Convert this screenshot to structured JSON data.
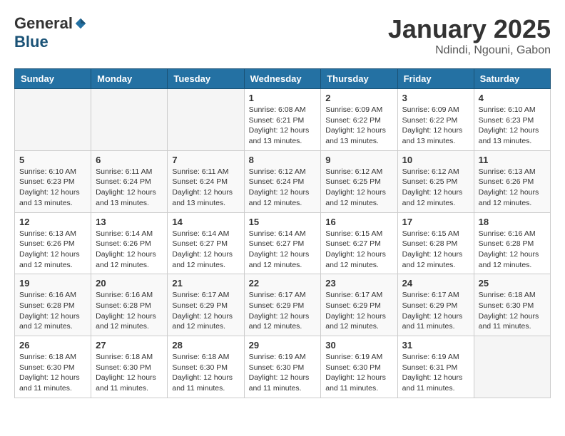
{
  "header": {
    "logo_general": "General",
    "logo_blue": "Blue",
    "month_title": "January 2025",
    "location": "Ndindi, Ngouni, Gabon"
  },
  "weekdays": [
    "Sunday",
    "Monday",
    "Tuesday",
    "Wednesday",
    "Thursday",
    "Friday",
    "Saturday"
  ],
  "weeks": [
    [
      {
        "day": "",
        "info": ""
      },
      {
        "day": "",
        "info": ""
      },
      {
        "day": "",
        "info": ""
      },
      {
        "day": "1",
        "info": "Sunrise: 6:08 AM\nSunset: 6:21 PM\nDaylight: 12 hours\nand 13 minutes."
      },
      {
        "day": "2",
        "info": "Sunrise: 6:09 AM\nSunset: 6:22 PM\nDaylight: 12 hours\nand 13 minutes."
      },
      {
        "day": "3",
        "info": "Sunrise: 6:09 AM\nSunset: 6:22 PM\nDaylight: 12 hours\nand 13 minutes."
      },
      {
        "day": "4",
        "info": "Sunrise: 6:10 AM\nSunset: 6:23 PM\nDaylight: 12 hours\nand 13 minutes."
      }
    ],
    [
      {
        "day": "5",
        "info": "Sunrise: 6:10 AM\nSunset: 6:23 PM\nDaylight: 12 hours\nand 13 minutes."
      },
      {
        "day": "6",
        "info": "Sunrise: 6:11 AM\nSunset: 6:24 PM\nDaylight: 12 hours\nand 13 minutes."
      },
      {
        "day": "7",
        "info": "Sunrise: 6:11 AM\nSunset: 6:24 PM\nDaylight: 12 hours\nand 13 minutes."
      },
      {
        "day": "8",
        "info": "Sunrise: 6:12 AM\nSunset: 6:24 PM\nDaylight: 12 hours\nand 12 minutes."
      },
      {
        "day": "9",
        "info": "Sunrise: 6:12 AM\nSunset: 6:25 PM\nDaylight: 12 hours\nand 12 minutes."
      },
      {
        "day": "10",
        "info": "Sunrise: 6:12 AM\nSunset: 6:25 PM\nDaylight: 12 hours\nand 12 minutes."
      },
      {
        "day": "11",
        "info": "Sunrise: 6:13 AM\nSunset: 6:26 PM\nDaylight: 12 hours\nand 12 minutes."
      }
    ],
    [
      {
        "day": "12",
        "info": "Sunrise: 6:13 AM\nSunset: 6:26 PM\nDaylight: 12 hours\nand 12 minutes."
      },
      {
        "day": "13",
        "info": "Sunrise: 6:14 AM\nSunset: 6:26 PM\nDaylight: 12 hours\nand 12 minutes."
      },
      {
        "day": "14",
        "info": "Sunrise: 6:14 AM\nSunset: 6:27 PM\nDaylight: 12 hours\nand 12 minutes."
      },
      {
        "day": "15",
        "info": "Sunrise: 6:14 AM\nSunset: 6:27 PM\nDaylight: 12 hours\nand 12 minutes."
      },
      {
        "day": "16",
        "info": "Sunrise: 6:15 AM\nSunset: 6:27 PM\nDaylight: 12 hours\nand 12 minutes."
      },
      {
        "day": "17",
        "info": "Sunrise: 6:15 AM\nSunset: 6:28 PM\nDaylight: 12 hours\nand 12 minutes."
      },
      {
        "day": "18",
        "info": "Sunrise: 6:16 AM\nSunset: 6:28 PM\nDaylight: 12 hours\nand 12 minutes."
      }
    ],
    [
      {
        "day": "19",
        "info": "Sunrise: 6:16 AM\nSunset: 6:28 PM\nDaylight: 12 hours\nand 12 minutes."
      },
      {
        "day": "20",
        "info": "Sunrise: 6:16 AM\nSunset: 6:28 PM\nDaylight: 12 hours\nand 12 minutes."
      },
      {
        "day": "21",
        "info": "Sunrise: 6:17 AM\nSunset: 6:29 PM\nDaylight: 12 hours\nand 12 minutes."
      },
      {
        "day": "22",
        "info": "Sunrise: 6:17 AM\nSunset: 6:29 PM\nDaylight: 12 hours\nand 12 minutes."
      },
      {
        "day": "23",
        "info": "Sunrise: 6:17 AM\nSunset: 6:29 PM\nDaylight: 12 hours\nand 12 minutes."
      },
      {
        "day": "24",
        "info": "Sunrise: 6:17 AM\nSunset: 6:29 PM\nDaylight: 12 hours\nand 11 minutes."
      },
      {
        "day": "25",
        "info": "Sunrise: 6:18 AM\nSunset: 6:30 PM\nDaylight: 12 hours\nand 11 minutes."
      }
    ],
    [
      {
        "day": "26",
        "info": "Sunrise: 6:18 AM\nSunset: 6:30 PM\nDaylight: 12 hours\nand 11 minutes."
      },
      {
        "day": "27",
        "info": "Sunrise: 6:18 AM\nSunset: 6:30 PM\nDaylight: 12 hours\nand 11 minutes."
      },
      {
        "day": "28",
        "info": "Sunrise: 6:18 AM\nSunset: 6:30 PM\nDaylight: 12 hours\nand 11 minutes."
      },
      {
        "day": "29",
        "info": "Sunrise: 6:19 AM\nSunset: 6:30 PM\nDaylight: 12 hours\nand 11 minutes."
      },
      {
        "day": "30",
        "info": "Sunrise: 6:19 AM\nSunset: 6:30 PM\nDaylight: 12 hours\nand 11 minutes."
      },
      {
        "day": "31",
        "info": "Sunrise: 6:19 AM\nSunset: 6:31 PM\nDaylight: 12 hours\nand 11 minutes."
      },
      {
        "day": "",
        "info": ""
      }
    ]
  ]
}
